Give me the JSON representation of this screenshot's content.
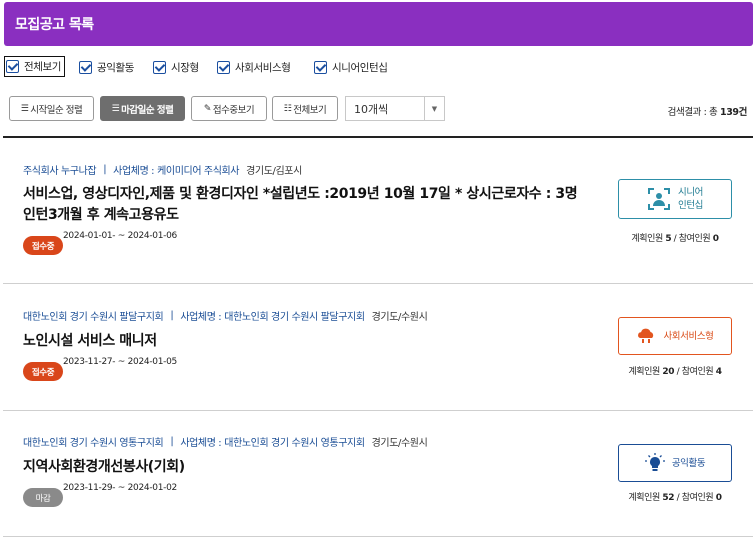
{
  "header": {
    "title": "모집공고 목록"
  },
  "filters": [
    {
      "label": "전체보기",
      "checked": true
    },
    {
      "label": "공익활동",
      "checked": true
    },
    {
      "label": "시장형",
      "checked": true
    },
    {
      "label": "사회서비스형",
      "checked": true
    },
    {
      "label": "시니어인턴십",
      "checked": true
    }
  ],
  "toolbar": {
    "sort_start": "시작일순 정렬",
    "sort_end": "마감일순 정렬",
    "accepting": "접수중보기",
    "view_all": "전체보기",
    "page_size": "10개씩",
    "result_prefix": "검색결과 : 총",
    "result_count": "139",
    "result_suffix": "건"
  },
  "labels": {
    "plan": "계획인원",
    "participants": "참여인원",
    "sep": "/",
    "biz": "사업체명 :"
  },
  "items": [
    {
      "org": "주식회사 누구나잡",
      "business": "케이미디어 주식회사",
      "location": "경기도/김포시",
      "title_line1": "서비스업, 영상디자인,제품 및 환경디자인 *설립년도 :2019년 10월 17일 * 상시근로자수 : 3명",
      "title_line2": "인턴3개월 후 계속고용유도",
      "status": "접수중",
      "dates": "2024-01-01- ~ 2024-01-06",
      "type_line1": "시니어",
      "type_line2": "인턴십",
      "type_icon": "senior-intern-icon",
      "plan": "5",
      "participants": "0"
    },
    {
      "org": "대한노인회 경기 수원시 팔달구지회",
      "business": "대한노인회 경기 수원시 팔달구지회",
      "location": "경기도/수원시",
      "title_line1": "노인시설 서비스 매니저",
      "title_line2": "",
      "status": "접수중",
      "dates": "2023-11-27- ~ 2024-01-05",
      "type_line1": "사회서비스형",
      "type_line2": "",
      "type_icon": "social-service-icon",
      "plan": "20",
      "participants": "4"
    },
    {
      "org": "대한노인회 경기 수원시 영통구지회",
      "business": "대한노인회 경기 수원시 영통구지회",
      "location": "경기도/수원시",
      "title_line1": "지역사회환경개선봉사(기회)",
      "title_line2": "",
      "status": "마감",
      "dates": "2023-11-29- ~ 2024-01-02",
      "type_line1": "공익활동",
      "type_line2": "",
      "type_icon": "public-activity-icon",
      "plan": "52",
      "participants": "0"
    }
  ],
  "colors": {
    "header_bg": "#8a2fc0",
    "accent_blue": "#1a4d95",
    "status_open": "#d9461a",
    "status_closed": "#8a8a8a",
    "senior_intern": "#2d8fa8",
    "social_service": "#e2551f"
  }
}
